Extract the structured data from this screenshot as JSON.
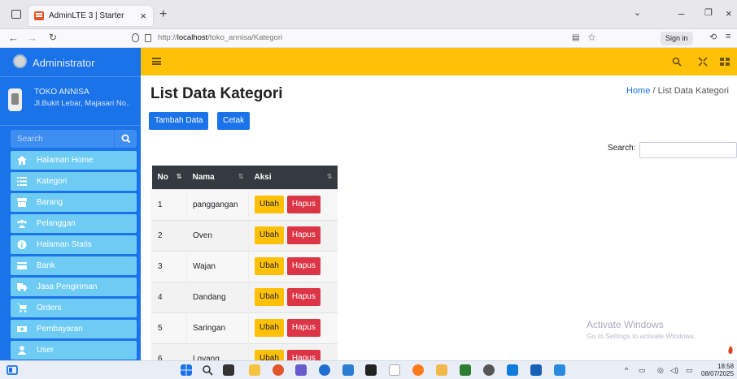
{
  "browser": {
    "tab_title": "AdminLTE 3 | Starter",
    "tab_close": "×",
    "new_tab": "+",
    "url_prefix": "http://",
    "url_host": "localhost",
    "url_path": "/toko_annisa/Kategori",
    "sign_in": "Sign in"
  },
  "sidebar": {
    "brand": "Administrator",
    "store_name": "TOKO ANNISA",
    "store_address": "Jl.Bukit Lebar, Majasari No..",
    "search_placeholder": "Search",
    "items": [
      {
        "label": "Halaman Home",
        "icon": "home-icon"
      },
      {
        "label": "Kategori",
        "icon": "list-icon"
      },
      {
        "label": "Barang",
        "icon": "box-icon"
      },
      {
        "label": "Pelanggan",
        "icon": "users-icon"
      },
      {
        "label": "Halaman Statis",
        "icon": "info-icon"
      },
      {
        "label": "Bank",
        "icon": "bank-icon"
      },
      {
        "label": "Jasa Pengiriman",
        "icon": "truck-icon"
      },
      {
        "label": "Orders",
        "icon": "cart-icon"
      },
      {
        "label": "Pembayaran",
        "icon": "money-icon"
      },
      {
        "label": "User",
        "icon": "user-icon"
      }
    ]
  },
  "page": {
    "title": "List Data Kategori",
    "breadcrumb_home": "Home",
    "breadcrumb_sep": "/",
    "breadcrumb_current": "List Data Kategori",
    "btn_add": "Tambah Data",
    "btn_print": "Cetak",
    "search_label": "Search:"
  },
  "table": {
    "headers": [
      "No",
      "Nama",
      "Aksi"
    ],
    "rows": [
      {
        "no": "1",
        "nama": "panggangan"
      },
      {
        "no": "2",
        "nama": "Oven"
      },
      {
        "no": "3",
        "nama": "Wajan"
      },
      {
        "no": "4",
        "nama": "Dandang"
      },
      {
        "no": "5",
        "nama": "Saringan"
      },
      {
        "no": "6",
        "nama": "Loyang"
      }
    ],
    "btn_edit": "Ubah",
    "btn_delete": "Hapus"
  },
  "watermark": {
    "title": "Activate Windows",
    "subtitle": "Go to Settings to activate Windows."
  },
  "taskbar": {
    "time": "18:58",
    "date": "08/07/2025"
  },
  "colors": {
    "sidebar": "#1a73e8",
    "menu_item": "#6ecbf4",
    "topbar": "#ffc107",
    "edit_button": "#ffc107",
    "delete_button": "#dc3545",
    "table_header": "#343a40"
  }
}
